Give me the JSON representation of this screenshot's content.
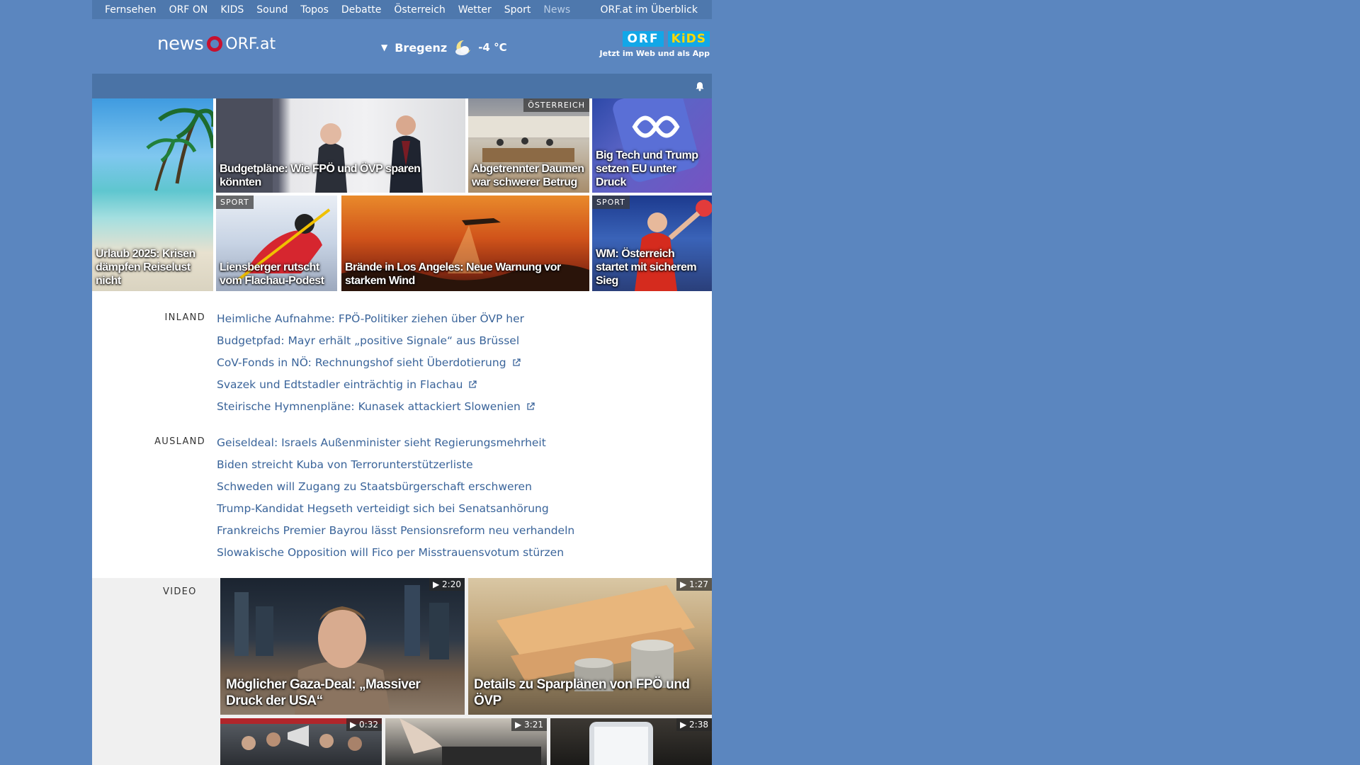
{
  "topnav": {
    "items": [
      "Fernsehen",
      "ORF ON",
      "KIDS",
      "Sound",
      "Topos",
      "Debatte",
      "Österreich",
      "Wetter",
      "Sport",
      "News"
    ],
    "active": "News",
    "overview": "ORF.at im Überblick"
  },
  "header": {
    "logo_news": "news",
    "logo_orf": "ORF.at",
    "weather_city": "Bregenz",
    "weather_temp": "-4 °C",
    "kids_orf": "ORF",
    "kids_kids": "KiDS",
    "kids_sub": "Jetzt im Web und als App"
  },
  "tiles": [
    {
      "caption": "Urlaub 2025: Krisen dämpfen Reiselust nicht",
      "tag": ""
    },
    {
      "caption": "Budgetpläne: Wie FPÖ und ÖVP sparen könnten",
      "tag": ""
    },
    {
      "caption": "Abgetrennter Daumen war schwerer Betrug",
      "tag": "ÖSTERREICH"
    },
    {
      "caption": "Big Tech und Trump setzen EU unter Druck",
      "tag": ""
    },
    {
      "caption": "Liensberger rutscht vom Flachau-Podest",
      "tag": "SPORT"
    },
    {
      "caption": "Brände in Los Angeles: Neue Warnung vor starkem Wind",
      "tag": ""
    },
    {
      "caption": "WM: Österreich startet mit sicherem Sieg",
      "tag": "SPORT"
    }
  ],
  "inland": {
    "label": "INLAND",
    "items": [
      "Heimliche Aufnahme: FPÖ-Politiker ziehen über ÖVP her",
      "Budgetpfad: Mayr erhält „positive Signale“ aus Brüssel",
      "CoV-Fonds in NÖ: Rechnungshof sieht Überdotierung",
      "Svazek und Edtstadler einträchtig in Flachau",
      "Steirische Hymnenpläne: Kunasek attackiert Slowenien"
    ]
  },
  "ausland": {
    "label": "AUSLAND",
    "items": [
      "Geiseldeal: Israels Außenminister sieht Regierungsmehrheit",
      "Biden streicht Kuba von Terrorunterstützerliste",
      "Schweden will Zugang zu Staatsbürgerschaft erschweren",
      "Trump-Kandidat Hegseth verteidigt sich bei Senatsanhörung",
      "Frankreichs Premier Bayrou lässt Pensionsreform neu verhandeln",
      "Slowakische Opposition will Fico per Misstrauensvotum stürzen"
    ]
  },
  "video": {
    "label": "VIDEO",
    "items": [
      {
        "caption": "Möglicher Gaza-Deal: „Massiver Druck der USA“",
        "duration": "▶ 2:20"
      },
      {
        "caption": "Details zu Sparplänen von FPÖ und ÖVP",
        "duration": "▶ 1:27"
      },
      {
        "caption": "",
        "duration": "▶ 0:32"
      },
      {
        "caption": "",
        "duration": "▶ 3:21"
      },
      {
        "caption": "",
        "duration": "▶ 2:38"
      }
    ]
  },
  "colors": {
    "page_bg": "#5b86bf",
    "link": "#3a649a",
    "orf_red": "#c8102e"
  },
  "icons": [
    "bell-icon",
    "external-link-icon",
    "moon-cloud-icon",
    "play-icon",
    "dropdown-caret-icon"
  ]
}
